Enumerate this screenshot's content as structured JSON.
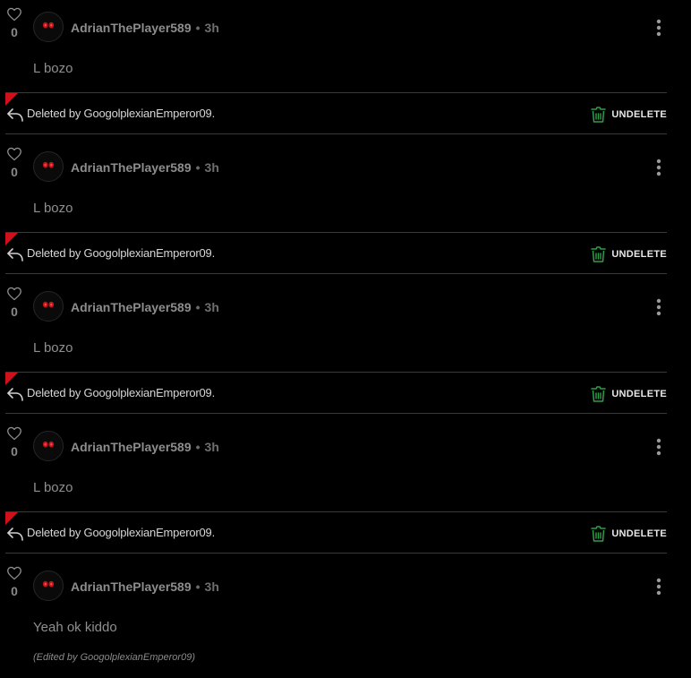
{
  "theme": {
    "background": "#000000",
    "flag_color": "#d0111c",
    "undelete_icon_color": "#2f9e4a",
    "avatar_eye_color": "#c4121c"
  },
  "comments": [
    {
      "like_count": "0",
      "username": "AdrianThePlayer589",
      "separator": "•",
      "time": "3h",
      "text": "L bozo",
      "deleted_notice": "Deleted by GoogolplexianEmperor09.",
      "undelete_label": "UNDELETE"
    },
    {
      "like_count": "0",
      "username": "AdrianThePlayer589",
      "separator": "•",
      "time": "3h",
      "text": "L bozo",
      "deleted_notice": "Deleted by GoogolplexianEmperor09.",
      "undelete_label": "UNDELETE"
    },
    {
      "like_count": "0",
      "username": "AdrianThePlayer589",
      "separator": "•",
      "time": "3h",
      "text": "L bozo",
      "deleted_notice": "Deleted by GoogolplexianEmperor09.",
      "undelete_label": "UNDELETE"
    },
    {
      "like_count": "0",
      "username": "AdrianThePlayer589",
      "separator": "•",
      "time": "3h",
      "text": "L bozo",
      "deleted_notice": "Deleted by GoogolplexianEmperor09.",
      "undelete_label": "UNDELETE"
    },
    {
      "like_count": "0",
      "username": "AdrianThePlayer589",
      "separator": "•",
      "time": "3h",
      "text": "Yeah ok kiddo",
      "edited_note": "(Edited by GoogolplexianEmperor09)"
    }
  ],
  "icons": {
    "like": "heart-icon",
    "avatar": "avatar-red-eyes",
    "more": "kebab-menu-icon",
    "reply": "reply-arrow-icon",
    "undelete": "trash-restore-icon"
  }
}
